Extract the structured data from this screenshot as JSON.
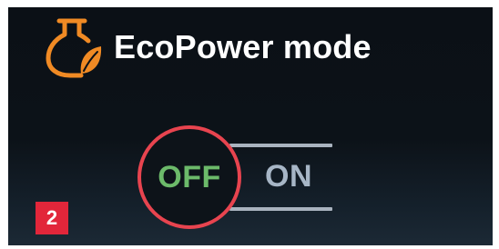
{
  "header": {
    "icon": "eco-engine-leaf-icon",
    "title": "EcoPower mode"
  },
  "toggle": {
    "off_label": "OFF",
    "on_label": "ON",
    "state": "OFF"
  },
  "badge": {
    "number": "2"
  },
  "colors": {
    "accent_orange": "#f08a24",
    "off_green": "#6cba6a",
    "selection_ring_red": "#e8444f",
    "badge_red": "#e2263a",
    "on_text": "#a7b6c6"
  }
}
